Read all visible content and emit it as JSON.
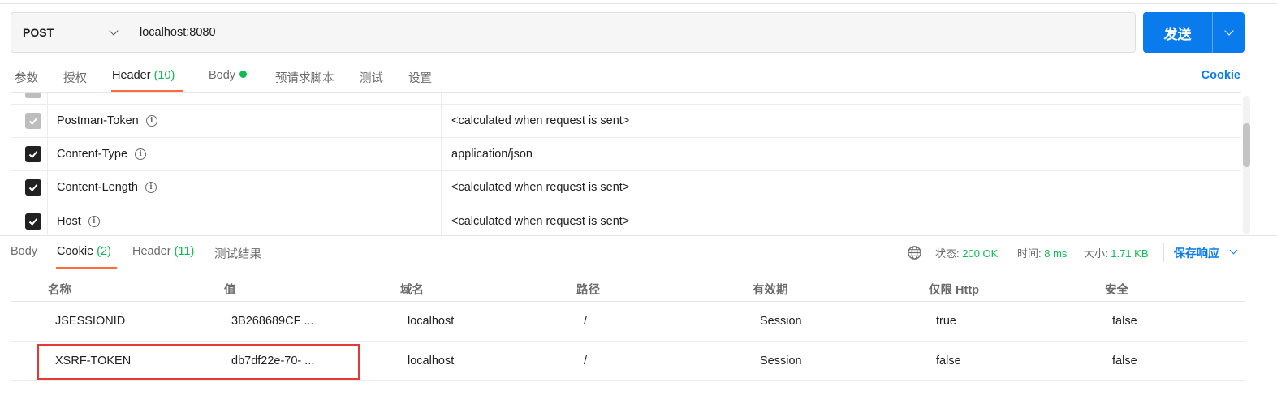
{
  "request": {
    "method": "POST",
    "url": "localhost:8080",
    "send_label": "发送"
  },
  "request_tabs": {
    "params": "参数",
    "auth": "授权",
    "header": "Header",
    "header_count": "(10)",
    "body": "Body",
    "prescript": "预请求脚本",
    "tests": "测试",
    "settings": "设置",
    "cookie_link": "Cookie"
  },
  "headers": [
    {
      "key": "Postman-Token",
      "value": "<calculated when request is sent>",
      "checked": true,
      "disabled": true
    },
    {
      "key": "Content-Type",
      "value": "application/json",
      "checked": true,
      "disabled": false
    },
    {
      "key": "Content-Length",
      "value": "<calculated when request is sent>",
      "checked": true,
      "disabled": false
    },
    {
      "key": "Host",
      "value": "<calculated when request is sent>",
      "checked": true,
      "disabled": false
    }
  ],
  "response_tabs": {
    "body": "Body",
    "cookie": "Cookie",
    "cookie_count": "(2)",
    "header": "Header",
    "header_count": "(11)",
    "test_results": "测试结果"
  },
  "response_status": {
    "status_label": "状态:",
    "status_value": "200 OK",
    "time_label": "时间:",
    "time_value": "8 ms",
    "size_label": "大小:",
    "size_value": "1.71 KB",
    "save_label": "保存响应"
  },
  "cookie_table": {
    "columns": [
      "名称",
      "值",
      "域名",
      "路径",
      "有效期",
      "仅限 Http",
      "安全"
    ],
    "rows": [
      [
        "JSESSIONID",
        "3B268689CF ...",
        "localhost",
        "/",
        "Session",
        "true",
        "false"
      ],
      [
        "XSRF-TOKEN",
        "db7df22e-70- ...",
        "localhost",
        "/",
        "Session",
        "false",
        "false"
      ]
    ]
  },
  "colors": {
    "accent_blue": "#097bed",
    "active_tab_underline": "#ff6c37",
    "success_green": "#0cbb52",
    "highlight_red": "#e53935"
  }
}
